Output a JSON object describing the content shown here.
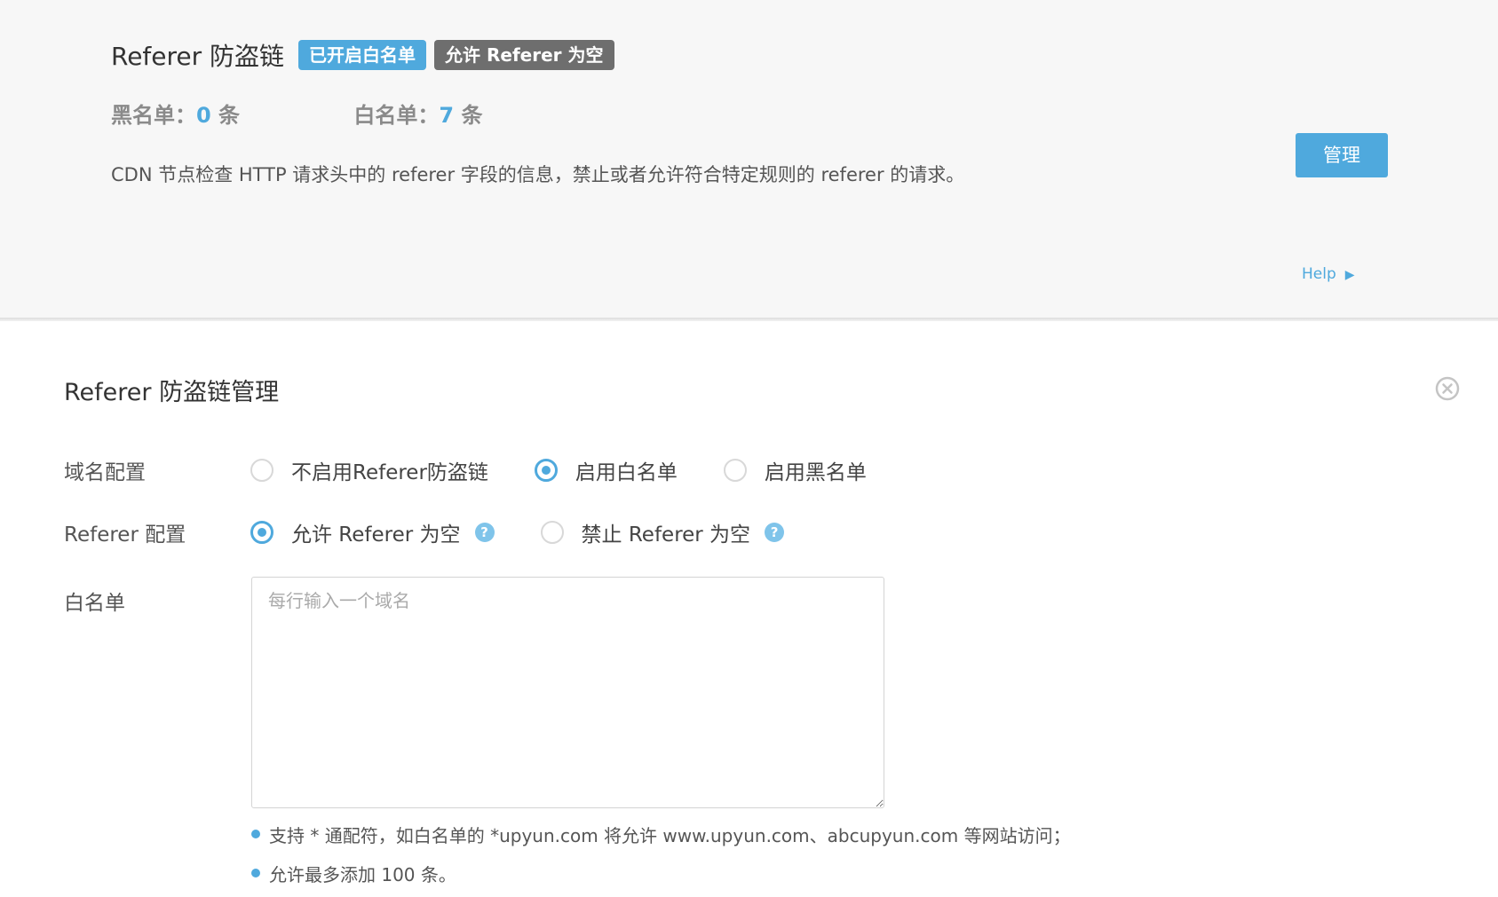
{
  "card": {
    "title": "Referer 防盗链",
    "badges": [
      "已开启白名单",
      "允许 Referer 为空"
    ],
    "blacklist": {
      "label": "黑名单：",
      "count": "0",
      "unit": " 条"
    },
    "whitelist": {
      "label": "白名单：",
      "count": "7",
      "unit": " 条"
    },
    "description": "CDN 节点检查 HTTP 请求头中的 referer 字段的信息，禁止或者允许符合特定规则的 referer 的请求。",
    "manage_label": "管理",
    "help_label": "Help",
    "help_arrow": "▶"
  },
  "panel": {
    "title": "Referer 防盗链管理",
    "domain_config": {
      "label": "域名配置",
      "options": [
        "不启用Referer防盗链",
        "启用白名单",
        "启用黑名单"
      ],
      "selected_index": 1
    },
    "referer_config": {
      "label": "Referer 配置",
      "options": [
        "允许 Referer 为空",
        "禁止 Referer 为空"
      ],
      "selected_index": 0
    },
    "whitelist_field": {
      "label": "白名单",
      "placeholder": "每行输入一个域名",
      "value": ""
    },
    "notes": [
      "支持 * 通配符，如白名单的 *upyun.com 将允许 www.upyun.com、abcupyun.com 等网站访问；",
      "允许最多添加 100 条。"
    ]
  },
  "colors": {
    "accent": "#4fa9dd",
    "badge_gray": "#6e6e6e"
  }
}
